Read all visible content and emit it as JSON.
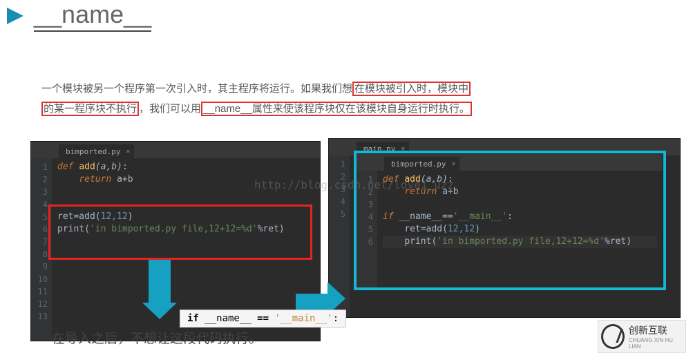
{
  "title": "__name__",
  "desc": {
    "p1a": "一个模块被另一个程序第一次引入时，其主程序将运行。如果我们想",
    "p1b": "在模块被引入时，模块中",
    "p2a": "的某一程序块不执行",
    "p2b": "，我们可以用",
    "p2c": "__name__属性来使该程序块仅在该模块自身运行时执行。"
  },
  "left_editor": {
    "tab": "bimported.py",
    "lines": [
      "1",
      "2",
      "3",
      "4",
      "5",
      "6",
      "7",
      "8",
      "9",
      "10",
      "11",
      "12",
      "13"
    ],
    "code": {
      "l1_kw": "def ",
      "l1_fn": "add",
      "l1_p": "(a,b)",
      "l1_c": ":",
      "l2_kw": "return ",
      "l2_t": "a+b",
      "l5": "ret=add(",
      "l5_n": "12,12",
      "l5_e": ")",
      "l6a": "print(",
      "l6s": "'in bimported.py file,12+12=%d'",
      "l6b": "%ret)"
    }
  },
  "right_outer_tab": "main.py",
  "right_editor": {
    "tab": "bimported.py",
    "lines": [
      "1",
      "2",
      "3",
      "4",
      "5",
      "6"
    ],
    "code": {
      "l1_kw": "def ",
      "l1_fn": "add",
      "l1_p": "(a,b)",
      "l1_c": ":",
      "l2_kw": "return ",
      "l2_t": "a+b",
      "l4_kw": "if ",
      "l4_t": "__name__==",
      "l4_s": "'__main__'",
      "l4_c": ":",
      "l5": "ret=add(",
      "l5_n": "12,12",
      "l5_e": ")",
      "l6a": "print(",
      "l6s": "'in bimported.py file,12+12=%d'",
      "l6b": "%ret)"
    }
  },
  "snippet": {
    "kw": "if",
    "name": " __name__ ",
    "eq": "==",
    "str": " '__main__'",
    "c": ":"
  },
  "overlay": "在导入之后，不想让这段代码执行。",
  "watermark": "http://blog.csdn.net/love1_uzz",
  "logo": {
    "brand": "创新互联",
    "sub": "CHUANG XIN HU LIAN"
  }
}
